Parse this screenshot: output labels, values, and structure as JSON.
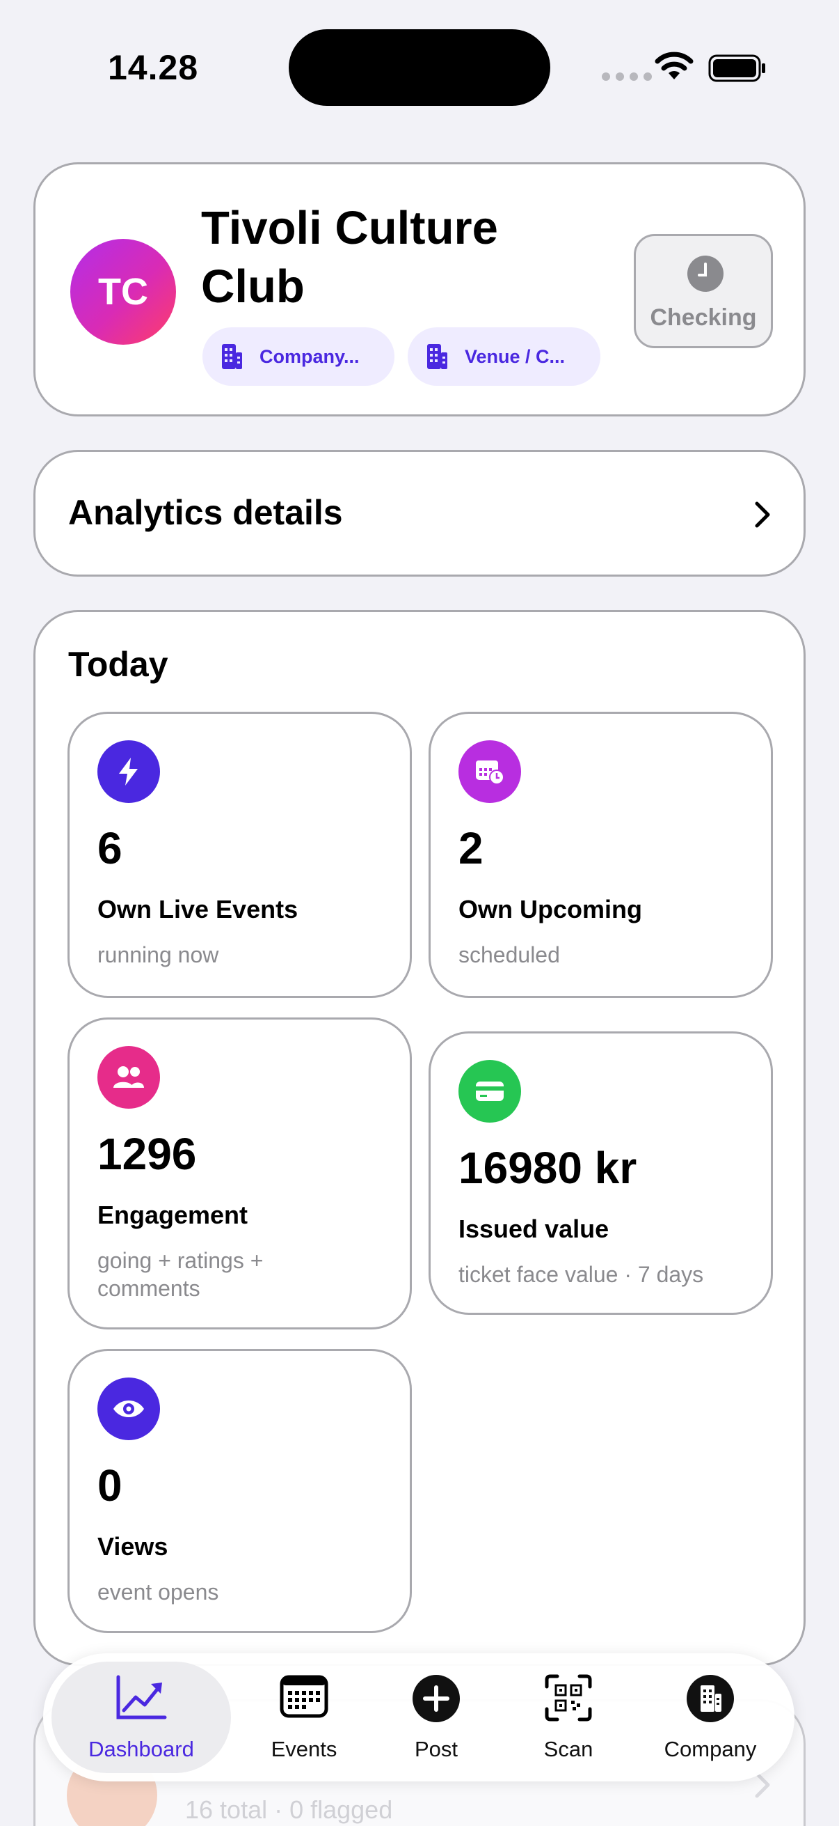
{
  "status_bar": {
    "time": "14.28"
  },
  "header": {
    "avatar_initials": "TC",
    "title": "Tivoli Culture Club",
    "chips": [
      {
        "label": "Company...",
        "icon": "building-icon"
      },
      {
        "label": "Venue / C...",
        "icon": "building-icon"
      }
    ],
    "checking_label": "Checking"
  },
  "analytics": {
    "label": "Analytics details"
  },
  "today": {
    "title": "Today",
    "stats": [
      {
        "value": "6",
        "title": "Own Live Events",
        "subtitle": "running now",
        "icon": "bolt-icon",
        "color": "#4a28e0"
      },
      {
        "value": "2",
        "title": "Own Upcoming",
        "subtitle": "scheduled",
        "icon": "calendar-clock-icon",
        "color": "#b82ee0"
      },
      {
        "value": "1296",
        "title": "Engagement",
        "subtitle": "going + ratings + comments",
        "icon": "people-icon",
        "color": "#e62c8a"
      },
      {
        "value": "16980 kr",
        "title": "Issued value",
        "subtitle": "ticket face value · 7 days",
        "icon": "card-icon",
        "color": "#26c653"
      },
      {
        "value": "0",
        "title": "Views",
        "subtitle": "event opens",
        "icon": "eye-icon",
        "color": "#4a28e0"
      }
    ]
  },
  "peek": {
    "subtitle": "16 total · 0 flagged"
  },
  "tabs": [
    {
      "label": "Dashboard",
      "icon": "chart-line-icon",
      "active": true
    },
    {
      "label": "Events",
      "icon": "calendar-icon"
    },
    {
      "label": "Post",
      "icon": "plus-circle-icon"
    },
    {
      "label": "Scan",
      "icon": "qr-scan-icon"
    },
    {
      "label": "Company",
      "icon": "building-circle-icon"
    }
  ],
  "colors": {
    "accent": "#4a28e0",
    "background": "#f2f2f7"
  }
}
